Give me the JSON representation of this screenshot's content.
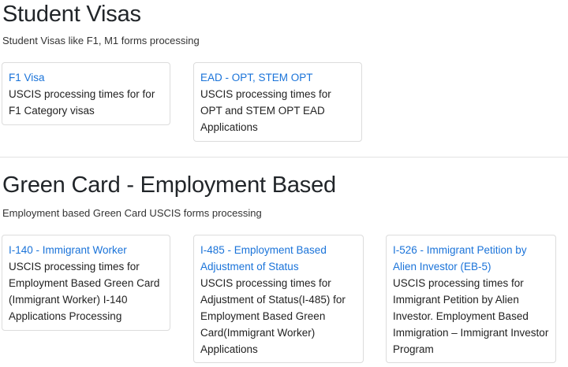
{
  "student": {
    "title": "Student Visas",
    "subtitle": "Student Visas like F1, M1 forms processing",
    "cards": [
      {
        "link": "F1 Visa",
        "desc": "USCIS processing times for for F1 Category visas"
      },
      {
        "link": "EAD - OPT, STEM OPT",
        "desc": "USCIS processing times for OPT and STEM OPT EAD Applications"
      }
    ]
  },
  "green_card": {
    "title": "Green Card - Employment Based",
    "subtitle": "Employment based Green Card USCIS forms processing",
    "cards": [
      {
        "link": "I-140 - Immigrant Worker",
        "desc": "USCIS processing times for Employment Based Green Card (Immigrant Worker) I-140 Applications Processing"
      },
      {
        "link": "I-485 - Employment Based Adjustment of Status",
        "desc": "USCIS processing times for Adjustment of Status(I-485) for Employment Based Green Card(Immigrant Worker) Applications"
      },
      {
        "link": "I-526 - Immigrant Petition by Alien Investor (EB-5)",
        "desc": "USCIS processing times for Immigrant Petition by Alien Investor. Employment Based Immigration – Immigrant Investor Program"
      }
    ]
  },
  "colors": {
    "link": "#1a73d9",
    "text": "#212529",
    "border": "#dcdcdc"
  }
}
